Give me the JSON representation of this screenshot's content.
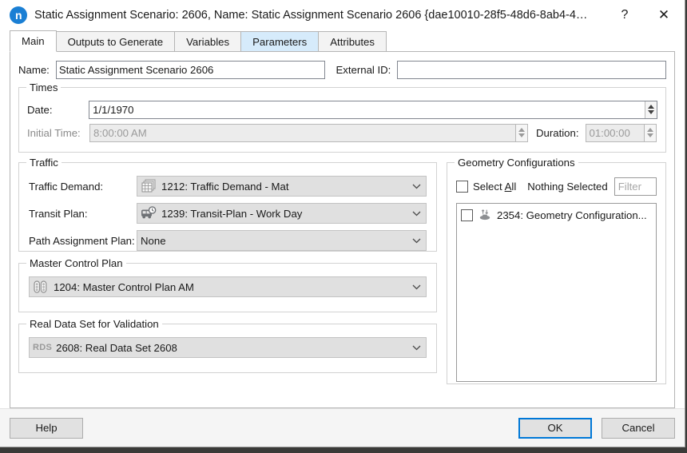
{
  "titlebar": {
    "app_icon": "n",
    "title": "Static Assignment Scenario: 2606, Name: Static Assignment Scenario 2606  {dae10010-28f5-48d6-8ab4-4…",
    "help_glyph": "?",
    "close_glyph": "✕"
  },
  "tabs": [
    {
      "label": "Main",
      "state": "selected"
    },
    {
      "label": "Outputs to Generate",
      "state": "normal"
    },
    {
      "label": "Variables",
      "state": "normal"
    },
    {
      "label": "Parameters",
      "state": "hovered"
    },
    {
      "label": "Attributes",
      "state": "normal"
    }
  ],
  "name_row": {
    "name_label": "Name:",
    "name_value": "Static Assignment Scenario 2606",
    "external_id_label": "External ID:",
    "external_id_value": ""
  },
  "times": {
    "group_title": "Times",
    "date_label": "Date:",
    "date_value": "1/1/1970",
    "initial_time_label": "Initial Time:",
    "initial_time_value": "8:00:00 AM",
    "duration_label": "Duration:",
    "duration_value": "01:00:00"
  },
  "traffic": {
    "group_title": "Traffic",
    "rows": [
      {
        "label": "Traffic Demand:",
        "value": "1212: Traffic Demand - Mat",
        "icon": "matrix-stack-icon"
      },
      {
        "label": "Transit Plan:",
        "value": "1239: Transit-Plan - Work Day",
        "icon": "bus-clock-icon"
      },
      {
        "label": "Path Assignment Plan:",
        "value": "None",
        "icon": "none"
      }
    ]
  },
  "master_control_plan": {
    "group_title": "Master Control Plan",
    "value": "1204: Master Control Plan AM",
    "icon": "traffic-light-icon"
  },
  "real_data_set": {
    "group_title": "Real Data Set for Validation",
    "icon_text": "RDS",
    "value": "2608: Real Data Set 2608"
  },
  "geometry": {
    "group_title": "Geometry Configurations",
    "select_all_label_pre": "Select ",
    "select_all_mnemonic": "A",
    "select_all_label_post": "ll",
    "selection_status": "Nothing Selected",
    "filter_placeholder": "Filter",
    "filter_value": "",
    "items": [
      {
        "label": "2354: Geometry Configuration...",
        "checked": false,
        "icon": "geometry-config-icon"
      }
    ]
  },
  "footer": {
    "help_label": "Help",
    "ok_label": "OK",
    "cancel_label": "Cancel"
  },
  "colors": {
    "accent": "#0078d7",
    "app_icon_bg": "#1a7fd4",
    "tab_hover": "#d6ebfb",
    "combo_bg": "#e0e0e0",
    "disabled_text": "#8a8a8a"
  }
}
